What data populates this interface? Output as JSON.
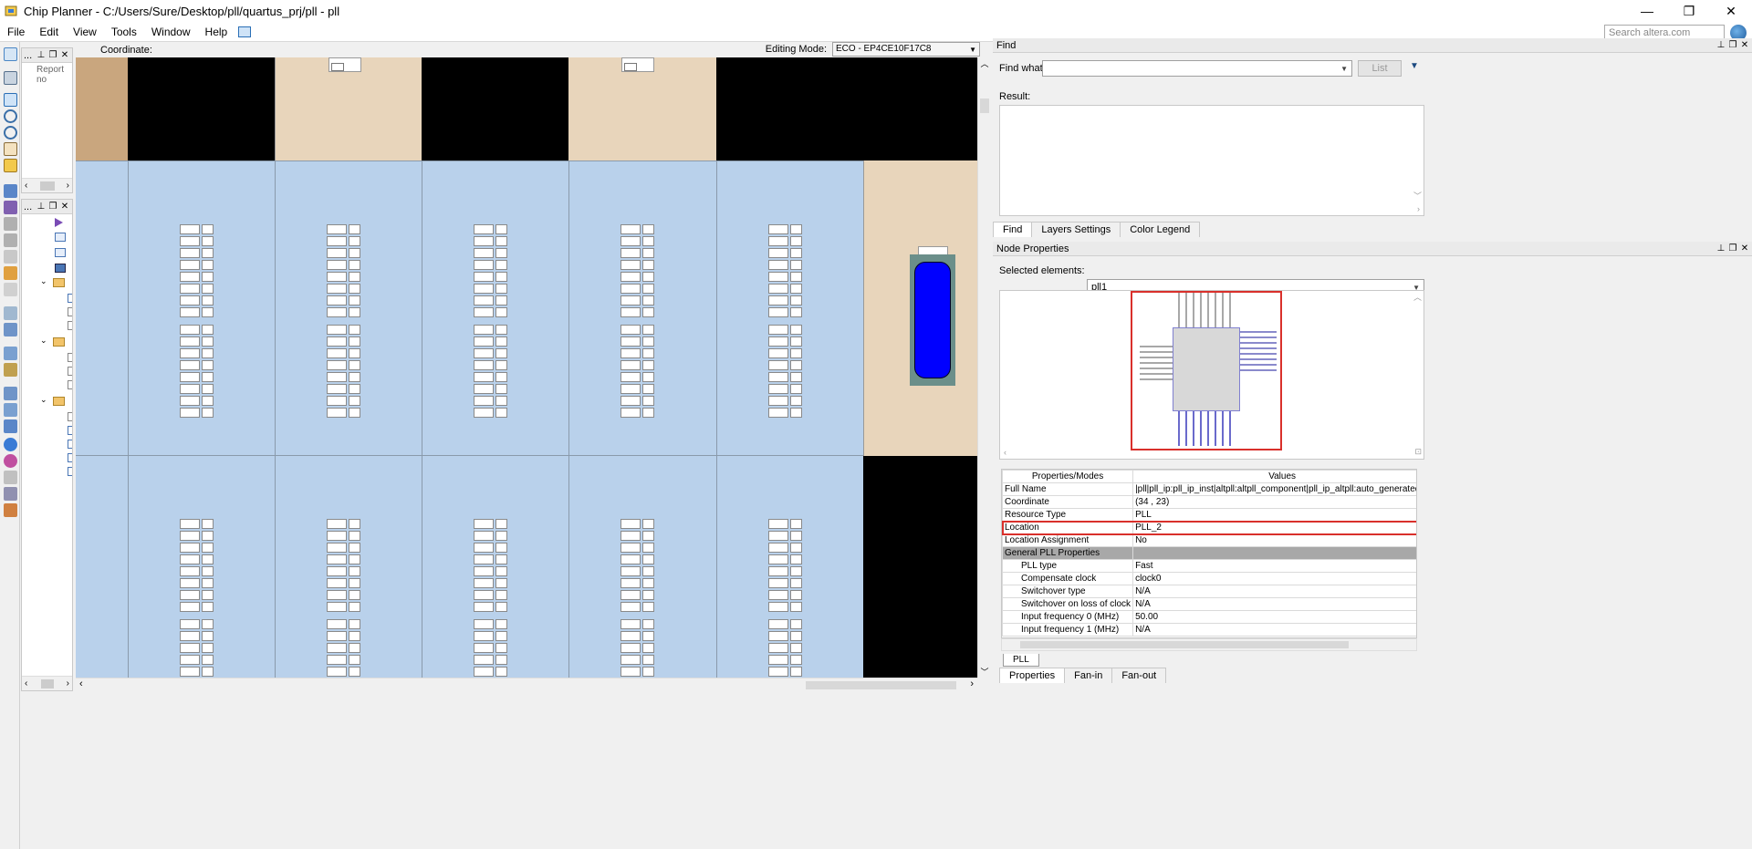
{
  "window": {
    "title": "Chip Planner - C:/Users/Sure/Desktop/pll/quartus_prj/pll - pll"
  },
  "menu": [
    "File",
    "Edit",
    "View",
    "Tools",
    "Window",
    "Help"
  ],
  "search": {
    "placeholder": "Search altera.com"
  },
  "left_panels": {
    "top_label": "...",
    "report_text": "Report no",
    "bottom_label": "..."
  },
  "canvas": {
    "coordinate_label": "Coordinate:",
    "editing_mode_label": "Editing Mode:",
    "editing_mode_value": "ECO - EP4CE10F17C8"
  },
  "find_panel": {
    "title": "Find",
    "find_what_label": "Find what:",
    "find_value": "",
    "list_button": "List",
    "result_label": "Result:"
  },
  "tabs": [
    "Find",
    "Layers Settings",
    "Color Legend"
  ],
  "node_properties": {
    "title": "Node Properties",
    "selected_label": "Selected elements:",
    "selected_value": "pll1",
    "headers": [
      "Properties/Modes",
      "Values"
    ],
    "rows": [
      {
        "name": "Full Name",
        "value": "|pll|pll_ip:pll_ip_inst|altpll:altpll_component|pll_ip_altpll:auto_generated|w"
      },
      {
        "name": "Coordinate",
        "value": "(34 , 23)"
      },
      {
        "name": "Resource Type",
        "value": "PLL"
      },
      {
        "name": "Location",
        "value": "PLL_2"
      },
      {
        "name": "Location Assignment",
        "value": "No"
      },
      {
        "name": "General PLL Properties",
        "value": ""
      },
      {
        "name": "PLL type",
        "value": "Fast"
      },
      {
        "name": "Compensate clock",
        "value": "clock0"
      },
      {
        "name": "Switchover type",
        "value": "N/A"
      },
      {
        "name": "Switchover on loss of clock",
        "value": "N/A"
      },
      {
        "name": "Input frequency 0 (MHz)",
        "value": "50.00"
      },
      {
        "name": "Input frequency 1 (MHz)",
        "value": "N/A"
      }
    ],
    "sheet_tab": "PLL",
    "bottom_tabs": [
      "Properties",
      "Fan-in",
      "Fan-out"
    ]
  },
  "colors": {
    "lab_blue": "#b9d1eb",
    "io_tan": "#e8d5bb",
    "io_dark": "#c9a67e",
    "pll_blue": "#0000ff",
    "pll_frame": "#6b8f8a",
    "highlight_red": "#d9302b"
  }
}
